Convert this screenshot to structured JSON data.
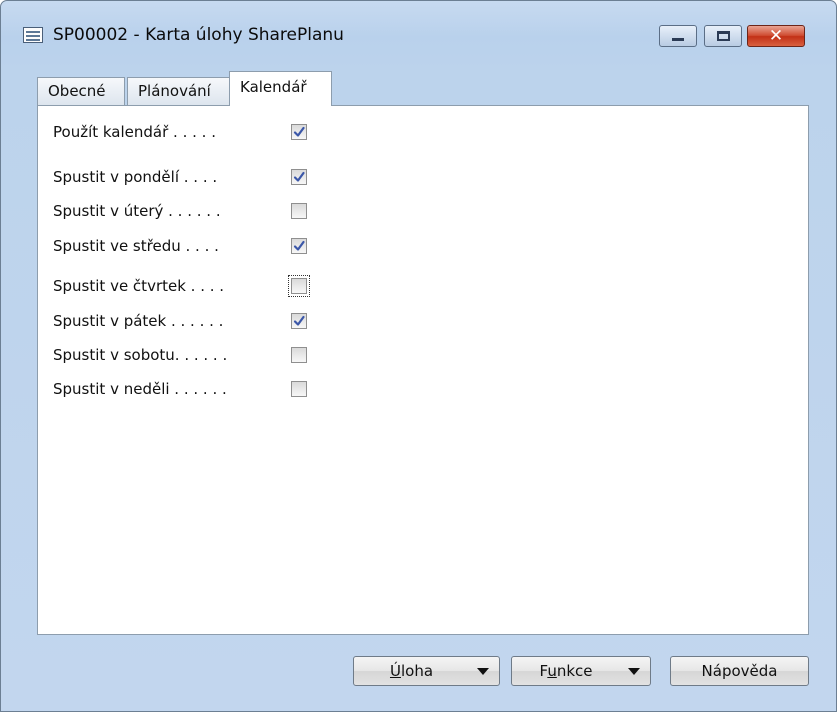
{
  "window": {
    "title": "SP00002 - Karta úlohy SharePlanu",
    "controls": {
      "minimize": "",
      "maximize": "",
      "close": "✕"
    }
  },
  "tabs": [
    {
      "label": "Obecné",
      "active": false
    },
    {
      "label": "Plánování",
      "active": false
    },
    {
      "label": "Kalendář",
      "active": true
    }
  ],
  "calendar": {
    "fields": [
      {
        "label": "Použít kalendář . . . . .",
        "checked": true
      },
      {
        "label": "Spustit v pondělí . . . .",
        "checked": true
      },
      {
        "label": "Spustit v úterý . . . . . .",
        "checked": false
      },
      {
        "label": "Spustit ve středu . . . .",
        "checked": true
      },
      {
        "label": "Spustit ve čtvrtek . . . .",
        "checked": false
      },
      {
        "label": "Spustit v pátek . . . . . .",
        "checked": true
      },
      {
        "label": "Spustit v sobotu. . . . . .",
        "checked": false
      },
      {
        "label": "Spustit v neděli . . . . . .",
        "checked": false
      }
    ]
  },
  "buttons": {
    "task_prefix": "Ú",
    "task_rest": "loha",
    "functions_prefix": "F",
    "functions_accel": "u",
    "functions_rest": "nkce",
    "help": "Nápověda"
  },
  "colors": {
    "check_mark": "#3b57a8",
    "close_button": "#c9391c",
    "title_bar": "#c7daf0"
  }
}
